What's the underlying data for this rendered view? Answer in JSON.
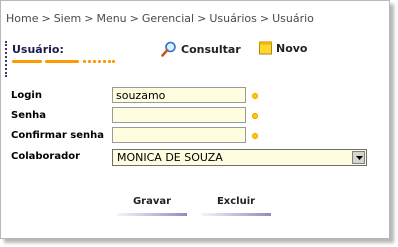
{
  "breadcrumb": {
    "items": [
      "Home",
      "Siem",
      "Menu",
      "Gerencial",
      "Usuários",
      "Usuário"
    ],
    "separator": ">"
  },
  "section": {
    "title": "Usuário:"
  },
  "toolbar": {
    "consultar_label": "Consultar",
    "novo_label": "Novo"
  },
  "form": {
    "login": {
      "label": "Login",
      "value": "souzamo"
    },
    "senha": {
      "label": "Senha",
      "value": ""
    },
    "confirmar_senha": {
      "label": "Confirmar senha",
      "value": ""
    },
    "colaborador": {
      "label": "Colaborador",
      "selected": "MONICA DE SOUZA"
    }
  },
  "actions": {
    "gravar_label": "Gravar",
    "excluir_label": "Excluir"
  },
  "colors": {
    "accent": "#ff9900",
    "input_bg": "#fffde0",
    "required": "#ffcc00",
    "title": "#1c1c4c"
  },
  "icons": {
    "consultar": "magnifier-icon",
    "novo": "note-icon",
    "required": "required-dot-icon",
    "select": "dropdown-arrow-icon"
  }
}
